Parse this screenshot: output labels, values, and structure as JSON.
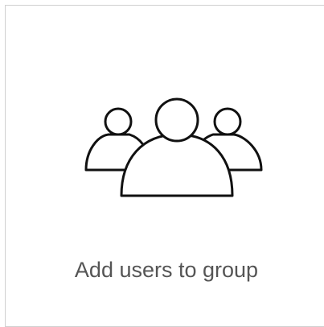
{
  "tile": {
    "icon": "users-group-icon",
    "label": "Add users to group"
  }
}
